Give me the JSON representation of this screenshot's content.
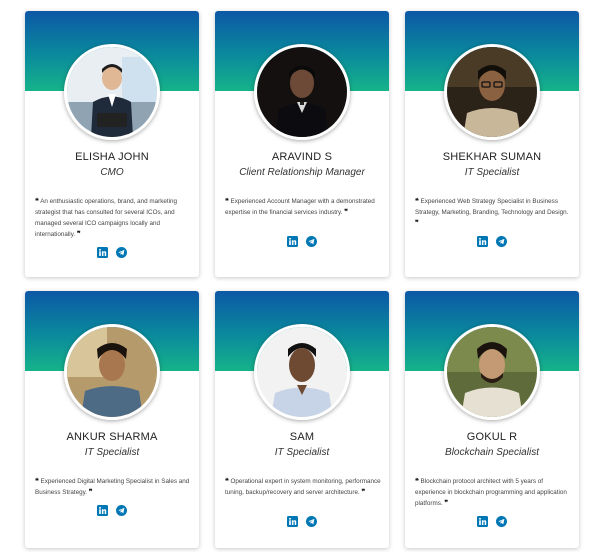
{
  "team": [
    {
      "name": "ELISHA JOHN",
      "role": "CMO",
      "bio": "An enthusiastic operations, brand, and marketing strategist that has consulted for several ICOs, and managed several ICO campaigns locally and internationally.",
      "photo": "photo-elisha"
    },
    {
      "name": "ARAVIND S",
      "role": "Client Relationship Manager",
      "bio": "Experienced Account Manager with a demonstrated expertise in the financial services industry.",
      "photo": "photo-aravind"
    },
    {
      "name": "SHEKHAR SUMAN",
      "role": "IT Specialist",
      "bio": "Experienced Web Strategy Specialist in Business Strategy, Marketing, Branding, Technology and Design.",
      "photo": "photo-shekhar"
    },
    {
      "name": "ANKUR SHARMA",
      "role": "IT Specialist",
      "bio": "Experienced Digital Marketing Specialist in Sales and Business Strategy.",
      "photo": "photo-ankur"
    },
    {
      "name": "SAM",
      "role": "IT Specialist",
      "bio": "Operational expert in system monitoring, performance tuning, backup/recovery and server architecture.",
      "photo": "photo-sam"
    },
    {
      "name": "GOKUL R",
      "role": "Blockchain Specialist",
      "bio": "Blockchain protocol architect with 5 years of experience in blockchain programming and application platforms.",
      "photo": "photo-gokul"
    }
  ],
  "icons": {
    "quote_open": "quote-open-icon",
    "quote_close": "quote-close-icon",
    "linkedin": "linkedin-icon",
    "telegram": "telegram-icon"
  },
  "colors": {
    "gradient_top": "#0d58a6",
    "gradient_bottom": "#16b38a",
    "social": "#0077b5"
  }
}
